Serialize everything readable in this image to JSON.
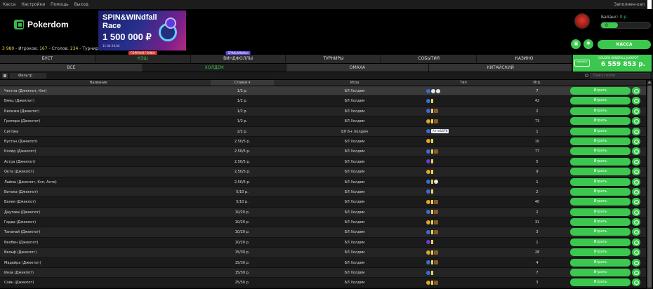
{
  "menu": [
    "Касса",
    "Настройки",
    "Помощь",
    "Выход"
  ],
  "menu_right": "Заполнен-хал",
  "logo": "Pokerdom",
  "stats": {
    "players_n": "3 980",
    "players_label": "- Игроков:",
    "tables_n": "167",
    "tables_label": "- Столов:",
    "tourn_n": "234",
    "tourn_label": "- Турниров"
  },
  "banner": {
    "line1": "SPIN&WINdfall",
    "line2": "Race",
    "amount": "1 500 000 ₽",
    "date": "11.04-20.04"
  },
  "balance": {
    "label": "Баланс:",
    "value": "0 р.",
    "bar_value": "0"
  },
  "kassa": "КАССА",
  "tabs1": [
    {
      "label": "БУСТ",
      "badge": ""
    },
    {
      "label": "КЭШ",
      "badge": "ГОРЯЧАЯ ГОНКА"
    },
    {
      "label": "ВИНДФОЛЛЫ",
      "badge": "SPIN&WINdfall"
    },
    {
      "label": "ТУРНИРЫ",
      "badge": ""
    },
    {
      "label": "СОБЫТИЯ",
      "badge": ""
    },
    {
      "label": "КАЗИНО",
      "badge": ""
    }
  ],
  "tabs2": [
    "ВСЕ",
    "ХОЛДЕМ",
    "ОМАХА",
    "КИТАЙСКИЙ"
  ],
  "jackpot": {
    "logo": "WINDFALL",
    "title": "GOLDEN WINDFALL JACKPOT",
    "amount": "6 559 853 р."
  },
  "filter": {
    "label": "Фильтр",
    "search_placeholder": "Поиск столов"
  },
  "columns": {
    "name": "Название",
    "stakes": "Ставки ▾",
    "game": "Игра",
    "type": "Тип",
    "players": "Игр."
  },
  "play_label": "Играть",
  "rows": [
    {
      "name": "Честна (Джекпот, Кэп)",
      "stake": "1/2 р.",
      "game": "БЛ Холдем",
      "icons": [
        "b",
        "w",
        "w"
      ],
      "ante": "",
      "players": "7"
    },
    {
      "name": "Вмец (Джекпот)",
      "stake": "1/2 р.",
      "game": "БЛ Холдем",
      "icons": [
        "b",
        "yel"
      ],
      "ante": "",
      "players": "42"
    },
    {
      "name": "Килижи (Джекпот)",
      "stake": "1/2 р.",
      "game": "БЛ Холдем",
      "icons": [
        "b",
        "yel",
        "dark"
      ],
      "ante": "",
      "players": "2"
    },
    {
      "name": "Грипора (Джекпот)",
      "stake": "1/2 р.",
      "game": "БЛ Холдем",
      "icons": [
        "o",
        "yel",
        "dark"
      ],
      "ante": "",
      "players": "73"
    },
    {
      "name": "Сигпжа",
      "stake": "2/2 р.",
      "game": "БЛ 6+ Холдем",
      "icons": [
        "b"
      ],
      "ante": "Анте&BTN",
      "players": "1"
    },
    {
      "name": "Вустан (Джекпот)",
      "stake": "2,50/5 р.",
      "game": "БЛ Холдем",
      "icons": [
        "o",
        "yel"
      ],
      "ante": "",
      "players": "10"
    },
    {
      "name": "Клэйд (Джекпот)",
      "stake": "2,50/5 р.",
      "game": "БЛ Холдем",
      "icons": [
        "b",
        "yel",
        "dark"
      ],
      "ante": "",
      "players": "77"
    },
    {
      "name": "Астра (Джекпот)",
      "stake": "2,50/5 р.",
      "game": "БЛ Холдем",
      "icons": [
        "p",
        "yel"
      ],
      "ante": "",
      "players": "5"
    },
    {
      "name": "Окта (Джекпот)",
      "stake": "2,50/5 р.",
      "game": "БЛ Холдем",
      "icons": [
        "o",
        "yel"
      ],
      "ante": "",
      "players": "9"
    },
    {
      "name": "Лайма (Джекпот, Кэп, Анте)",
      "stake": "2,50/5 р.",
      "game": "БЛ Холдем",
      "icons": [
        "b",
        "yel",
        "w"
      ],
      "ante": "",
      "players": "1"
    },
    {
      "name": "Витока (Джекпот)",
      "stake": "5/10 р.",
      "game": "БЛ Холдем",
      "icons": [
        "b",
        "yel"
      ],
      "ante": "",
      "players": "2"
    },
    {
      "name": "Валея (Джекпот)",
      "stake": "5/10 р.",
      "game": "БЛ Холдем",
      "icons": [
        "o",
        "yel",
        "dark"
      ],
      "ante": "",
      "players": "40"
    },
    {
      "name": "Даутава (Джекпот)",
      "stake": "10/20 р.",
      "game": "БЛ Холдем",
      "icons": [
        "b",
        "yel",
        "dark"
      ],
      "ante": "",
      "players": "2"
    },
    {
      "name": "Гарда (Джекпот)",
      "stake": "10/20 р.",
      "game": "БЛ Холдем",
      "icons": [
        "o",
        "yel",
        "dark"
      ],
      "ante": "",
      "players": "31"
    },
    {
      "name": "Тананай (Джекпот)",
      "stake": "10/20 р.",
      "game": "БЛ Холдем",
      "icons": [
        "b",
        "yel",
        "dark"
      ],
      "ante": "",
      "players": "3"
    },
    {
      "name": "Велбен (Джекпот)",
      "stake": "10/20 р.",
      "game": "БЛ Холдем",
      "icons": [
        "p",
        "yel"
      ],
      "ante": "",
      "players": "1"
    },
    {
      "name": "Вельф (Джекпот)",
      "stake": "15/30 р.",
      "game": "БЛ Холдем",
      "icons": [
        "o",
        "yel",
        "dark"
      ],
      "ante": "",
      "players": "28"
    },
    {
      "name": "Мадейра (Джекпот)",
      "stake": "15/30 р.",
      "game": "БЛ Холдем",
      "icons": [
        "b",
        "yel",
        "dark"
      ],
      "ante": "",
      "players": "4"
    },
    {
      "name": "Инза (Джекпот)",
      "stake": "15/30 р.",
      "game": "БЛ Холдем",
      "icons": [
        "b",
        "yel"
      ],
      "ante": "",
      "players": "7"
    },
    {
      "name": "Сойн (Джекпот)",
      "stake": "25/50 р.",
      "game": "БЛ Холдем",
      "icons": [
        "o",
        "yel",
        "dark"
      ],
      "ante": "",
      "players": "3"
    }
  ]
}
